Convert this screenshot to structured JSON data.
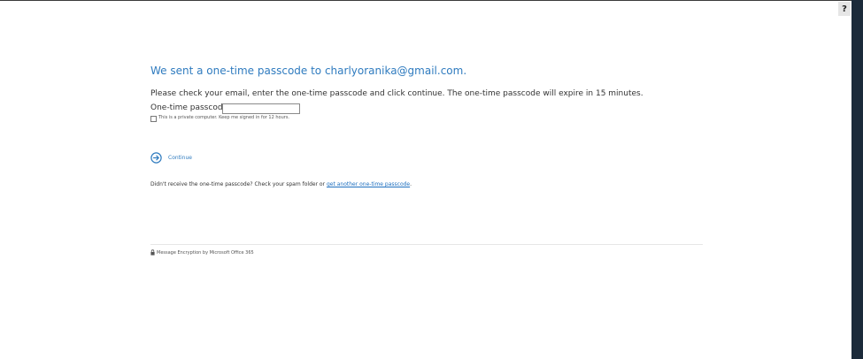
{
  "help": {
    "label": "?"
  },
  "heading": "We sent a one-time passcode to charlyoranika@gmail.com.",
  "instructions": "Please check your email, enter the one-time passcode and click continue. The one-time passcode will expire in 15 minutes.",
  "passcode": {
    "label": "One-time passcode",
    "value": ""
  },
  "remember": {
    "label": "This is a private computer. Keep me signed in for 12 hours.",
    "checked": false
  },
  "continue": {
    "label": "Continue",
    "icon": "arrow-circle-right-icon"
  },
  "resend": {
    "text": "Didn't receive the one-time passcode? Check your spam folder or ",
    "link": "get another one-time passcode",
    "suffix": "."
  },
  "footer": {
    "text": "Message Encryption by Microsoft Office 365",
    "icon": "lock-icon"
  },
  "colors": {
    "accent": "#2f7bbf",
    "link": "#1e6fbf",
    "sidebar": "#1b2a3a"
  }
}
